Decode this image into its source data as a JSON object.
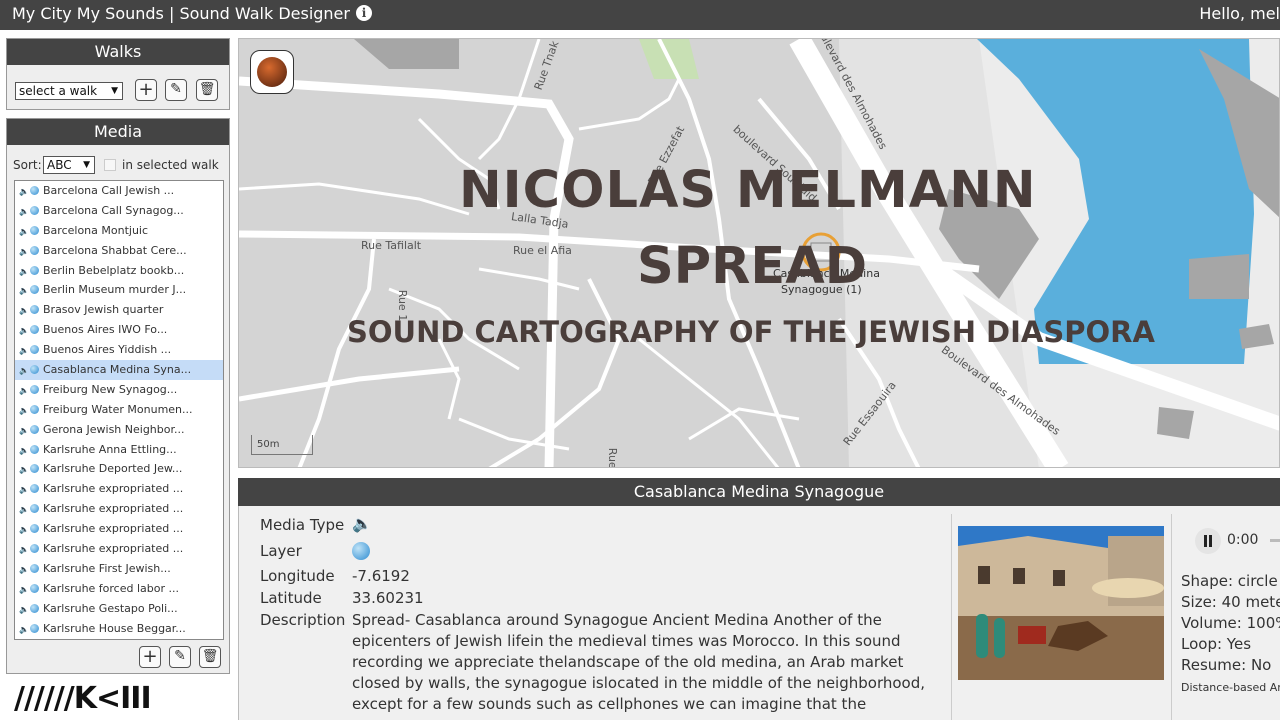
{
  "header": {
    "title": "My City My Sounds | Sound Walk Designer",
    "info_glyph": "i",
    "greeting": "Hello, mel"
  },
  "walks": {
    "title": "Walks",
    "select_value": "select a walk",
    "add_glyph": "+",
    "edit_glyph": "✎",
    "delete_glyph": "🗑"
  },
  "media": {
    "title": "Media",
    "sort_label": "Sort:",
    "sort_value": "ABC",
    "in_walk_label": "in selected walk",
    "items": [
      "Barcelona Call Jewish ...",
      "Barcelona Call Synagog...",
      "Barcelona Montjuic",
      "Barcelona Shabbat Cere...",
      "Berlin Bebelplatz bookb...",
      "Berlin Museum murder J...",
      "Brasov Jewish quarter",
      "Buenos Aires IWO Fo...",
      "Buenos Aires Yiddish ...",
      "Casablanca Medina Syna...",
      "Freiburg New Synagog...",
      "Freiburg Water Monumen...",
      "Gerona Jewish Neighbor...",
      "Karlsruhe Anna Ettling...",
      "Karlsruhe Deported Jew...",
      "Karlsruhe expropriated ...",
      "Karlsruhe expropriated ...",
      "Karlsruhe expropriated ...",
      "Karlsruhe expropriated ...",
      "Karlsruhe First Jewish...",
      "Karlsruhe forced labor ...",
      "Karlsruhe Gestapo Poli...",
      "Karlsruhe House Beggar..."
    ],
    "selected_index": 9
  },
  "map": {
    "overlay_line1": "NICOLAS MELMANN",
    "overlay_line2": "SPREAD",
    "overlay_line3": "SOUND CARTOGRAPHY OF THE JEWISH DIASPORA",
    "marker_label_1": "Casablanca Medina",
    "marker_label_2": "Synagogue (1)",
    "scale_label": "50m",
    "streets": {
      "s1": "Rue Tafilalt",
      "s2": "Rue el Afia",
      "s3": "Lalla Tadja",
      "s4": "boulevard Sour Jdid",
      "s5": "Rue Ezzefat",
      "s6": "boulevard des Almohades",
      "s7": "Boulevard des Almohades",
      "s8": "Rue Essaouira",
      "s9": "Rue 1",
      "s10": "Rue Tnak",
      "s11": "Rue 1"
    },
    "water_color": "#5aafdc"
  },
  "detail": {
    "title": "Casablanca Medina Synagogue",
    "media_type_label": "Media Type",
    "layer_label": "Layer",
    "longitude_label": "Longitude",
    "longitude_value": "-7.6192",
    "latitude_label": "Latitude",
    "latitude_value": "33.60231",
    "description_label": "Description",
    "description": "Spread- Casablanca around Synagogue Ancient Medina Another of the epicenters of Jewish lifein the medieval times was Morocco. In this sound recording we appreciate thelandscape of the old medina, an Arab market closed by walls, the synagogue islocated in the middle of the neighborhood, except for a few sounds such as cellphones we can imagine that the",
    "audio_time": "0:00",
    "properties": [
      "Shape: circle",
      "Size: 40 mete",
      "Volume: 100%",
      "Loop: Yes",
      "Resume: No"
    ],
    "distance_note": "Distance-based Ar"
  },
  "logo": {
    "text": "//////K<III"
  }
}
